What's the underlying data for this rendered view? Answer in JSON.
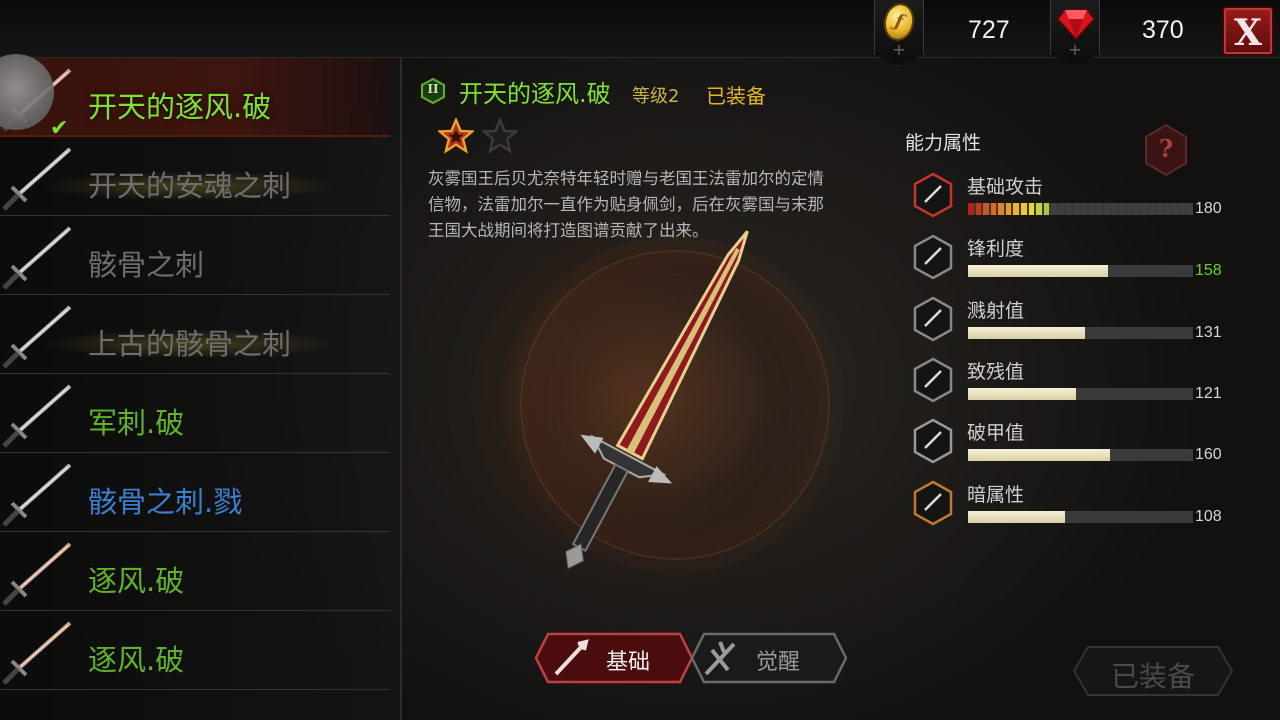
{
  "currency": {
    "coins": "727",
    "gems": "370",
    "coin_glyph": "ƒ"
  },
  "close_label": "X",
  "weapon_list": [
    {
      "name": "开天的逐风.破",
      "color": "#7ee233",
      "selected": true
    },
    {
      "name": "开天的安魂之刺",
      "color": "#6e6e6e"
    },
    {
      "name": "骸骨之刺",
      "color": "#6e6e6e"
    },
    {
      "name": "上古的骸骨之刺",
      "color": "#6e6e6e"
    },
    {
      "name": "军刺.破",
      "color": "#5fb22a"
    },
    {
      "name": "骸骨之刺.戮",
      "color": "#3c7fd0"
    },
    {
      "name": "逐风.破",
      "color": "#5fb22a"
    },
    {
      "name": "逐风.破",
      "color": "#5fb22a"
    }
  ],
  "detail": {
    "tier": "II",
    "name": "开天的逐风.破",
    "level": "等级2",
    "equipped": "已装备",
    "stars_filled": 1,
    "stars_total": 2,
    "description": "灰雾国王后贝尤奈特年轻时赠与老国王法雷加尔的定情信物，法雷加尔一直作为贴身佩剑，后在灰雾国与末那王国大战期间将打造图谱贡献了出来。"
  },
  "stats": {
    "title": "能力属性",
    "help_glyph": "?",
    "items": [
      {
        "label": "基础攻击",
        "value": "180",
        "value_color": "#d6d6d6",
        "icon": "attack-icon",
        "segmented": true,
        "segments_filled": 11,
        "segments_total": 30
      },
      {
        "label": "锋利度",
        "value": "158",
        "value_color": "#5fd02a",
        "icon": "sharpness-icon",
        "fill": 0.62
      },
      {
        "label": "溅射值",
        "value": "131",
        "value_color": "#d6d6d6",
        "icon": "splash-icon",
        "fill": 0.52
      },
      {
        "label": "致残值",
        "value": "121",
        "value_color": "#d6d6d6",
        "icon": "cripple-icon",
        "fill": 0.48
      },
      {
        "label": "破甲值",
        "value": "160",
        "value_color": "#d6d6d6",
        "icon": "armor-break-icon",
        "fill": 0.63
      },
      {
        "label": "暗属性",
        "value": "108",
        "value_color": "#d6d6d6",
        "icon": "dark-element-icon",
        "fill": 0.43
      }
    ]
  },
  "tabs": {
    "basic": "基础",
    "awaken": "觉醒"
  },
  "equip_button": "已装备"
}
